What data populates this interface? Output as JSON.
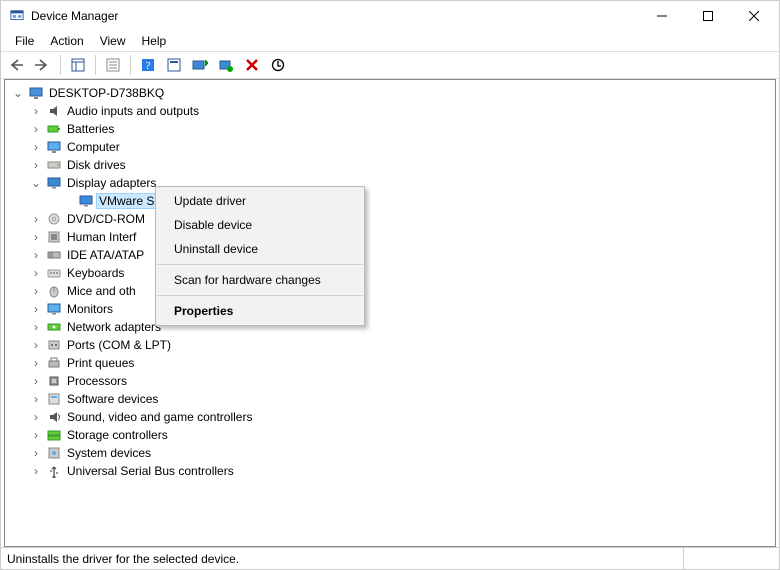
{
  "window": {
    "title": "Device Manager"
  },
  "menubar": {
    "file": "File",
    "action": "Action",
    "view": "View",
    "help": "Help"
  },
  "tree": {
    "root": "DESKTOP-D738BKQ",
    "items": [
      {
        "label": "Audio inputs and outputs",
        "icon": "audio"
      },
      {
        "label": "Batteries",
        "icon": "battery"
      },
      {
        "label": "Computer",
        "icon": "computer"
      },
      {
        "label": "Disk drives",
        "icon": "disk"
      },
      {
        "label": "Display adapters",
        "icon": "display",
        "expanded": true
      },
      {
        "label": "DVD/CD-ROM",
        "icon": "dvd",
        "truncated": true
      },
      {
        "label": "Human Interf",
        "icon": "hid",
        "truncated": true
      },
      {
        "label": "IDE ATA/ATAP",
        "icon": "ide",
        "truncated": true
      },
      {
        "label": "Keyboards",
        "icon": "keyboard"
      },
      {
        "label": "Mice and oth",
        "icon": "mouse",
        "truncated": true
      },
      {
        "label": "Monitors",
        "icon": "monitor"
      },
      {
        "label": "Network adapters",
        "icon": "network"
      },
      {
        "label": "Ports (COM & LPT)",
        "icon": "ports"
      },
      {
        "label": "Print queues",
        "icon": "printer"
      },
      {
        "label": "Processors",
        "icon": "cpu"
      },
      {
        "label": "Software devices",
        "icon": "software"
      },
      {
        "label": "Sound, video and game controllers",
        "icon": "sound"
      },
      {
        "label": "Storage controllers",
        "icon": "storage"
      },
      {
        "label": "System devices",
        "icon": "system"
      },
      {
        "label": "Universal Serial Bus controllers",
        "icon": "usb"
      }
    ],
    "display_child": "VMware S"
  },
  "context_menu": {
    "update": "Update driver",
    "disable": "Disable device",
    "uninstall": "Uninstall device",
    "scan": "Scan for hardware changes",
    "properties": "Properties"
  },
  "statusbar": {
    "text": "Uninstalls the driver for the selected device."
  }
}
